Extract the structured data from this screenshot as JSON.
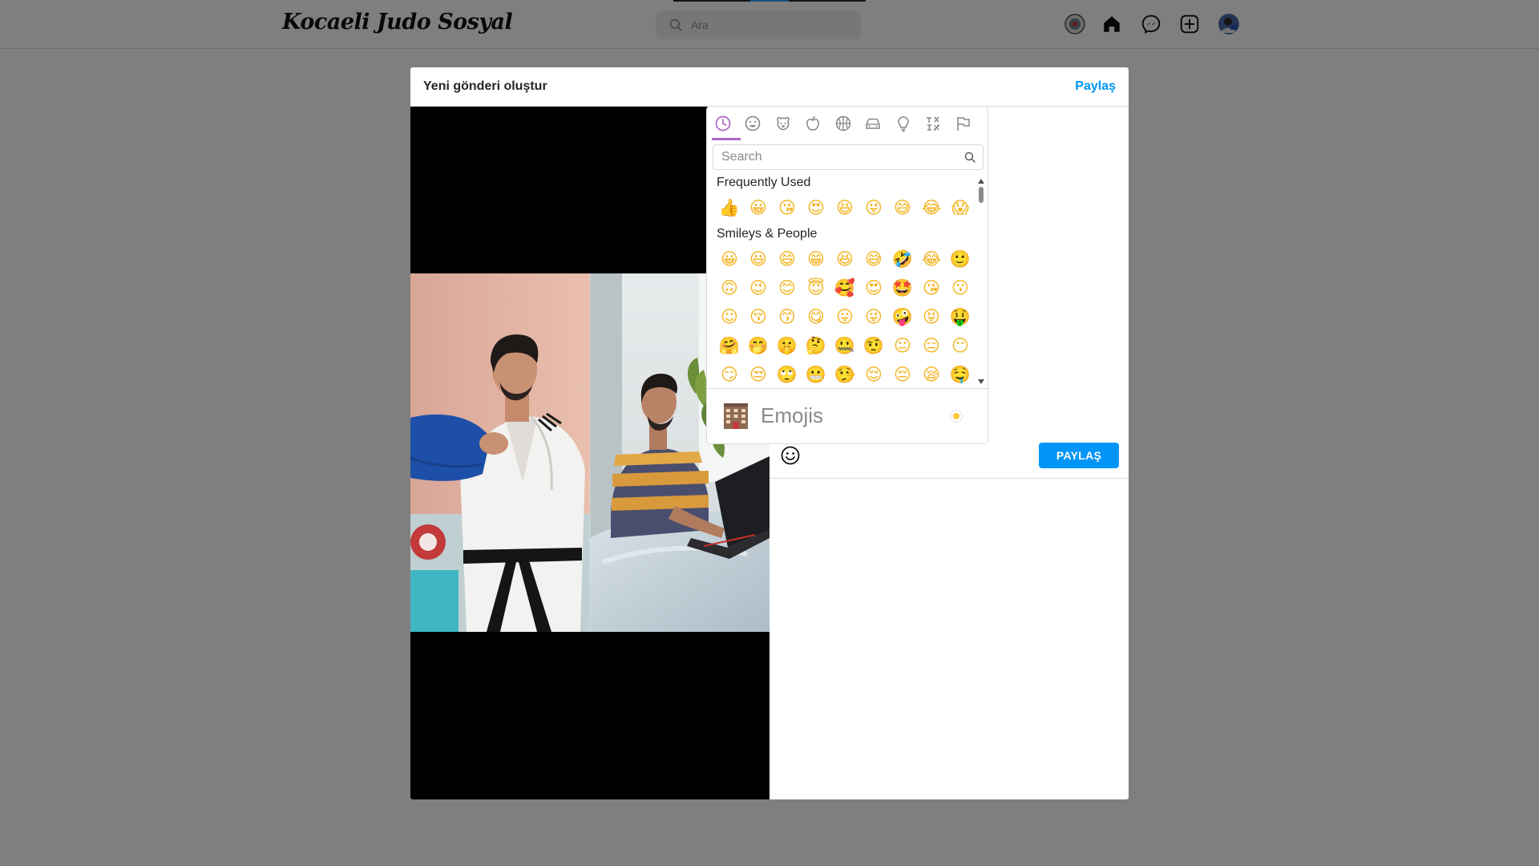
{
  "navbar": {
    "brand": "Kocaeli Judo Sosyal",
    "search": {
      "placeholder": "Ara"
    },
    "icons": [
      "federation-logo-icon",
      "home-icon",
      "messenger-icon",
      "create-post-icon",
      "profile-avatar"
    ]
  },
  "modal": {
    "title": "Yeni gönderi oluştur",
    "share_link": "Paylaş",
    "share_button": "PAYLAŞ"
  },
  "emoji_picker": {
    "category_icons": [
      "clock-icon",
      "smiley-icon",
      "animal-icon",
      "food-icon",
      "ball-icon",
      "car-icon",
      "lightbulb-icon",
      "symbols-icon",
      "flag-icon"
    ],
    "search_placeholder": "Search",
    "sections": [
      {
        "title": "Frequently Used",
        "rows": [
          [
            "👍",
            "😀",
            "😘",
            "😍",
            "😆",
            "😜",
            "😅",
            "😂",
            "😱"
          ]
        ]
      },
      {
        "title": "Smileys & People",
        "rows": [
          [
            "😀",
            "😃",
            "😄",
            "😁",
            "😆",
            "😅",
            "🤣",
            "😂",
            "🙂"
          ],
          [
            "🙃",
            "😉",
            "😊",
            "😇",
            "🥰",
            "😍",
            "🤩",
            "😘",
            "😗"
          ],
          [
            "☺",
            "😚",
            "😙",
            "😋",
            "😛",
            "😜",
            "🤪",
            "😝",
            "🤑"
          ],
          [
            "🤗",
            "🤭",
            "🤫",
            "🤔",
            "🤐",
            "🤨",
            "😐",
            "😑",
            "😶"
          ],
          [
            "😏",
            "😒",
            "🙄",
            "😬",
            "🤥",
            "😌",
            "😔",
            "😪",
            "🤤"
          ]
        ]
      }
    ],
    "preview_label": "Emojis",
    "preview_emoji": "office-building-icon"
  },
  "colors": {
    "accent": "#0095f6",
    "picker_accent": "#ae65c5",
    "overlay": "rgba(0,0,0,0.5)"
  }
}
